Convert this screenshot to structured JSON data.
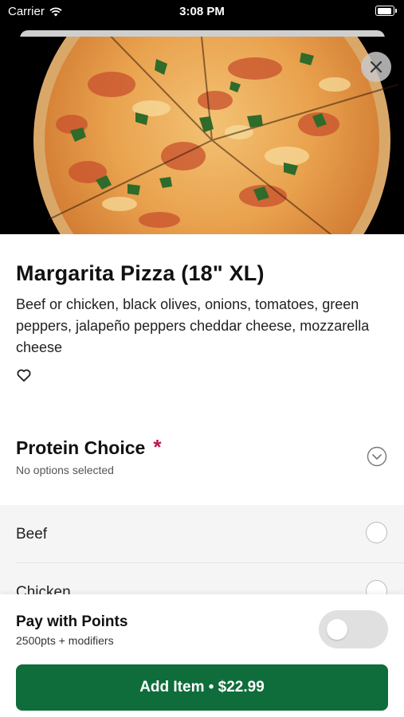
{
  "status_bar": {
    "carrier": "Carrier",
    "time": "3:08 PM"
  },
  "item": {
    "title": "Margarita Pizza (18\" XL)",
    "description": "Beef or chicken, black olives, onions, tomatoes, green peppers, jalapeño peppers cheddar cheese, mozzarella cheese"
  },
  "protein": {
    "title": "Protein Choice",
    "required_marker": "*",
    "subtitle": "No options selected",
    "options": [
      {
        "label": "Beef"
      },
      {
        "label": "Chicken"
      }
    ]
  },
  "footer": {
    "pay_with_points_title": "Pay with Points",
    "pay_with_points_subtitle": "2500pts + modifiers",
    "pay_with_points_enabled": false,
    "add_button_label": "Add Item • $22.99"
  },
  "icons": {
    "wifi": "wifi-icon",
    "battery": "battery-icon",
    "close": "close-icon",
    "favorite": "heart-icon",
    "expand": "chevron-down-icon"
  },
  "colors": {
    "primary_button": "#0e6d3a",
    "required": "#c0144a",
    "option_bg": "#f5f5f5"
  }
}
